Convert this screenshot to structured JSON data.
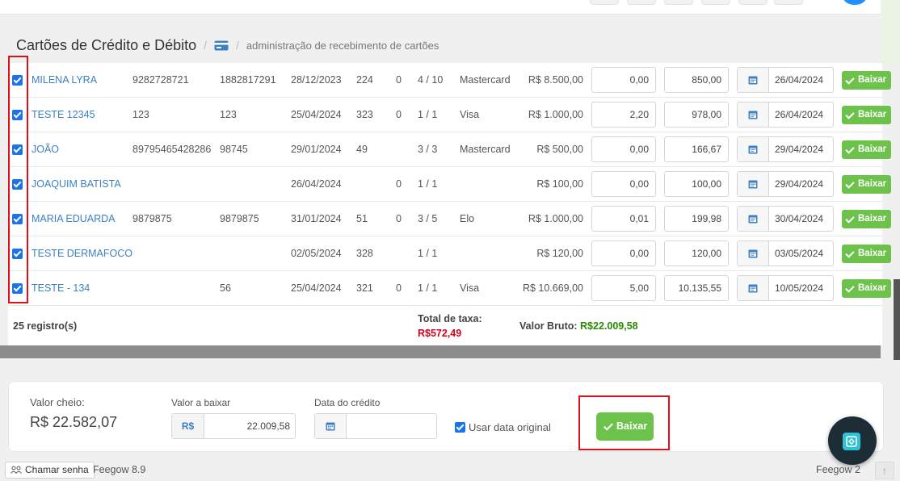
{
  "header": {
    "title": "Cartões de Crédito e Débito",
    "breadcrumb": "administração de recebimento de cartões"
  },
  "rows": [
    {
      "checked": true,
      "name": "MILENA LYRA",
      "c1": "9282728721",
      "c2": "1882817291",
      "date": "28/12/2023",
      "c3": "224",
      "c4": "0",
      "parcela": "4 / 10",
      "bandeira": "Mastercard",
      "valor": "R$ 8.500,00",
      "taxa": "0,00",
      "liquido": "850,00",
      "credito": "26/04/2024",
      "action": "Baixar"
    },
    {
      "checked": true,
      "name": "TESTE 12345",
      "c1": "123",
      "c2": "123",
      "date": "25/04/2024",
      "c3": "323",
      "c4": "0",
      "parcela": "1 / 1",
      "bandeira": "Visa",
      "valor": "R$ 1.000,00",
      "taxa": "2,20",
      "liquido": "978,00",
      "credito": "26/04/2024",
      "action": "Baixar"
    },
    {
      "checked": true,
      "name": "JOÃO",
      "c1": "89795465428286",
      "c2": "98745",
      "date": "29/01/2024",
      "c3": "49",
      "c4": "",
      "parcela": "3 / 3",
      "bandeira": "Mastercard",
      "valor": "R$ 500,00",
      "taxa": "0,00",
      "liquido": "166,67",
      "credito": "29/04/2024",
      "action": "Baixar"
    },
    {
      "checked": true,
      "name": "JOAQUIM BATISTA",
      "c1": "",
      "c2": "",
      "date": "26/04/2024",
      "c3": "",
      "c4": "0",
      "parcela": "1 / 1",
      "bandeira": "",
      "valor": "R$ 100,00",
      "taxa": "0,00",
      "liquido": "100,00",
      "credito": "29/04/2024",
      "action": "Baixar"
    },
    {
      "checked": true,
      "name": "MARIA EDUARDA",
      "c1": "9879875",
      "c2": "9879875",
      "date": "31/01/2024",
      "c3": "51",
      "c4": "0",
      "parcela": "3 / 5",
      "bandeira": "Elo",
      "valor": "R$ 1.000,00",
      "taxa": "0,01",
      "liquido": "199,98",
      "credito": "30/04/2024",
      "action": "Baixar"
    },
    {
      "checked": true,
      "name": "TESTE DERMAFOCO",
      "c1": "",
      "c2": "",
      "date": "02/05/2024",
      "c3": "328",
      "c4": "",
      "parcela": "1 / 1",
      "bandeira": "",
      "valor": "R$ 120,00",
      "taxa": "0,00",
      "liquido": "120,00",
      "credito": "03/05/2024",
      "action": "Baixar"
    },
    {
      "checked": true,
      "name": "TESTE - 134",
      "c1": "",
      "c2": "56",
      "date": "25/04/2024",
      "c3": "321",
      "c4": "0",
      "parcela": "1 / 1",
      "bandeira": "Visa",
      "valor": "R$ 10.669,00",
      "taxa": "5,00",
      "liquido": "10.135,55",
      "credito": "10/05/2024",
      "action": "Baixar"
    }
  ],
  "table_footer": {
    "registros": "25 registro(s)",
    "total_taxa_label": "Total de taxa:",
    "total_taxa_value": "R$572,49",
    "valor_bruto_label": "Valor Bruto:",
    "valor_bruto_value": "R$22.009,58"
  },
  "summary": {
    "valor_cheio_label": "Valor cheio:",
    "valor_cheio_value": "R$ 22.582,07",
    "valor_baixar_label": "Valor a baixar",
    "currency_prefix": "R$",
    "valor_baixar_value": "22.009,58",
    "data_credito_label": "Data do crédito",
    "data_credito_value": "",
    "usar_data_original_label": "Usar data original",
    "usar_data_original_checked": true,
    "baixar_button": "Baixar"
  },
  "statusbar": {
    "chamar_senha": "Chamar senha",
    "version_left": "Feegow 8.9",
    "version_right": "Feegow 2"
  },
  "colors": {
    "accent_blue": "#3b7fc4",
    "success_green": "#6dc24b",
    "total_red": "#d0021b",
    "bruto_green": "#2a8a00",
    "highlight_red": "#e0101a"
  }
}
